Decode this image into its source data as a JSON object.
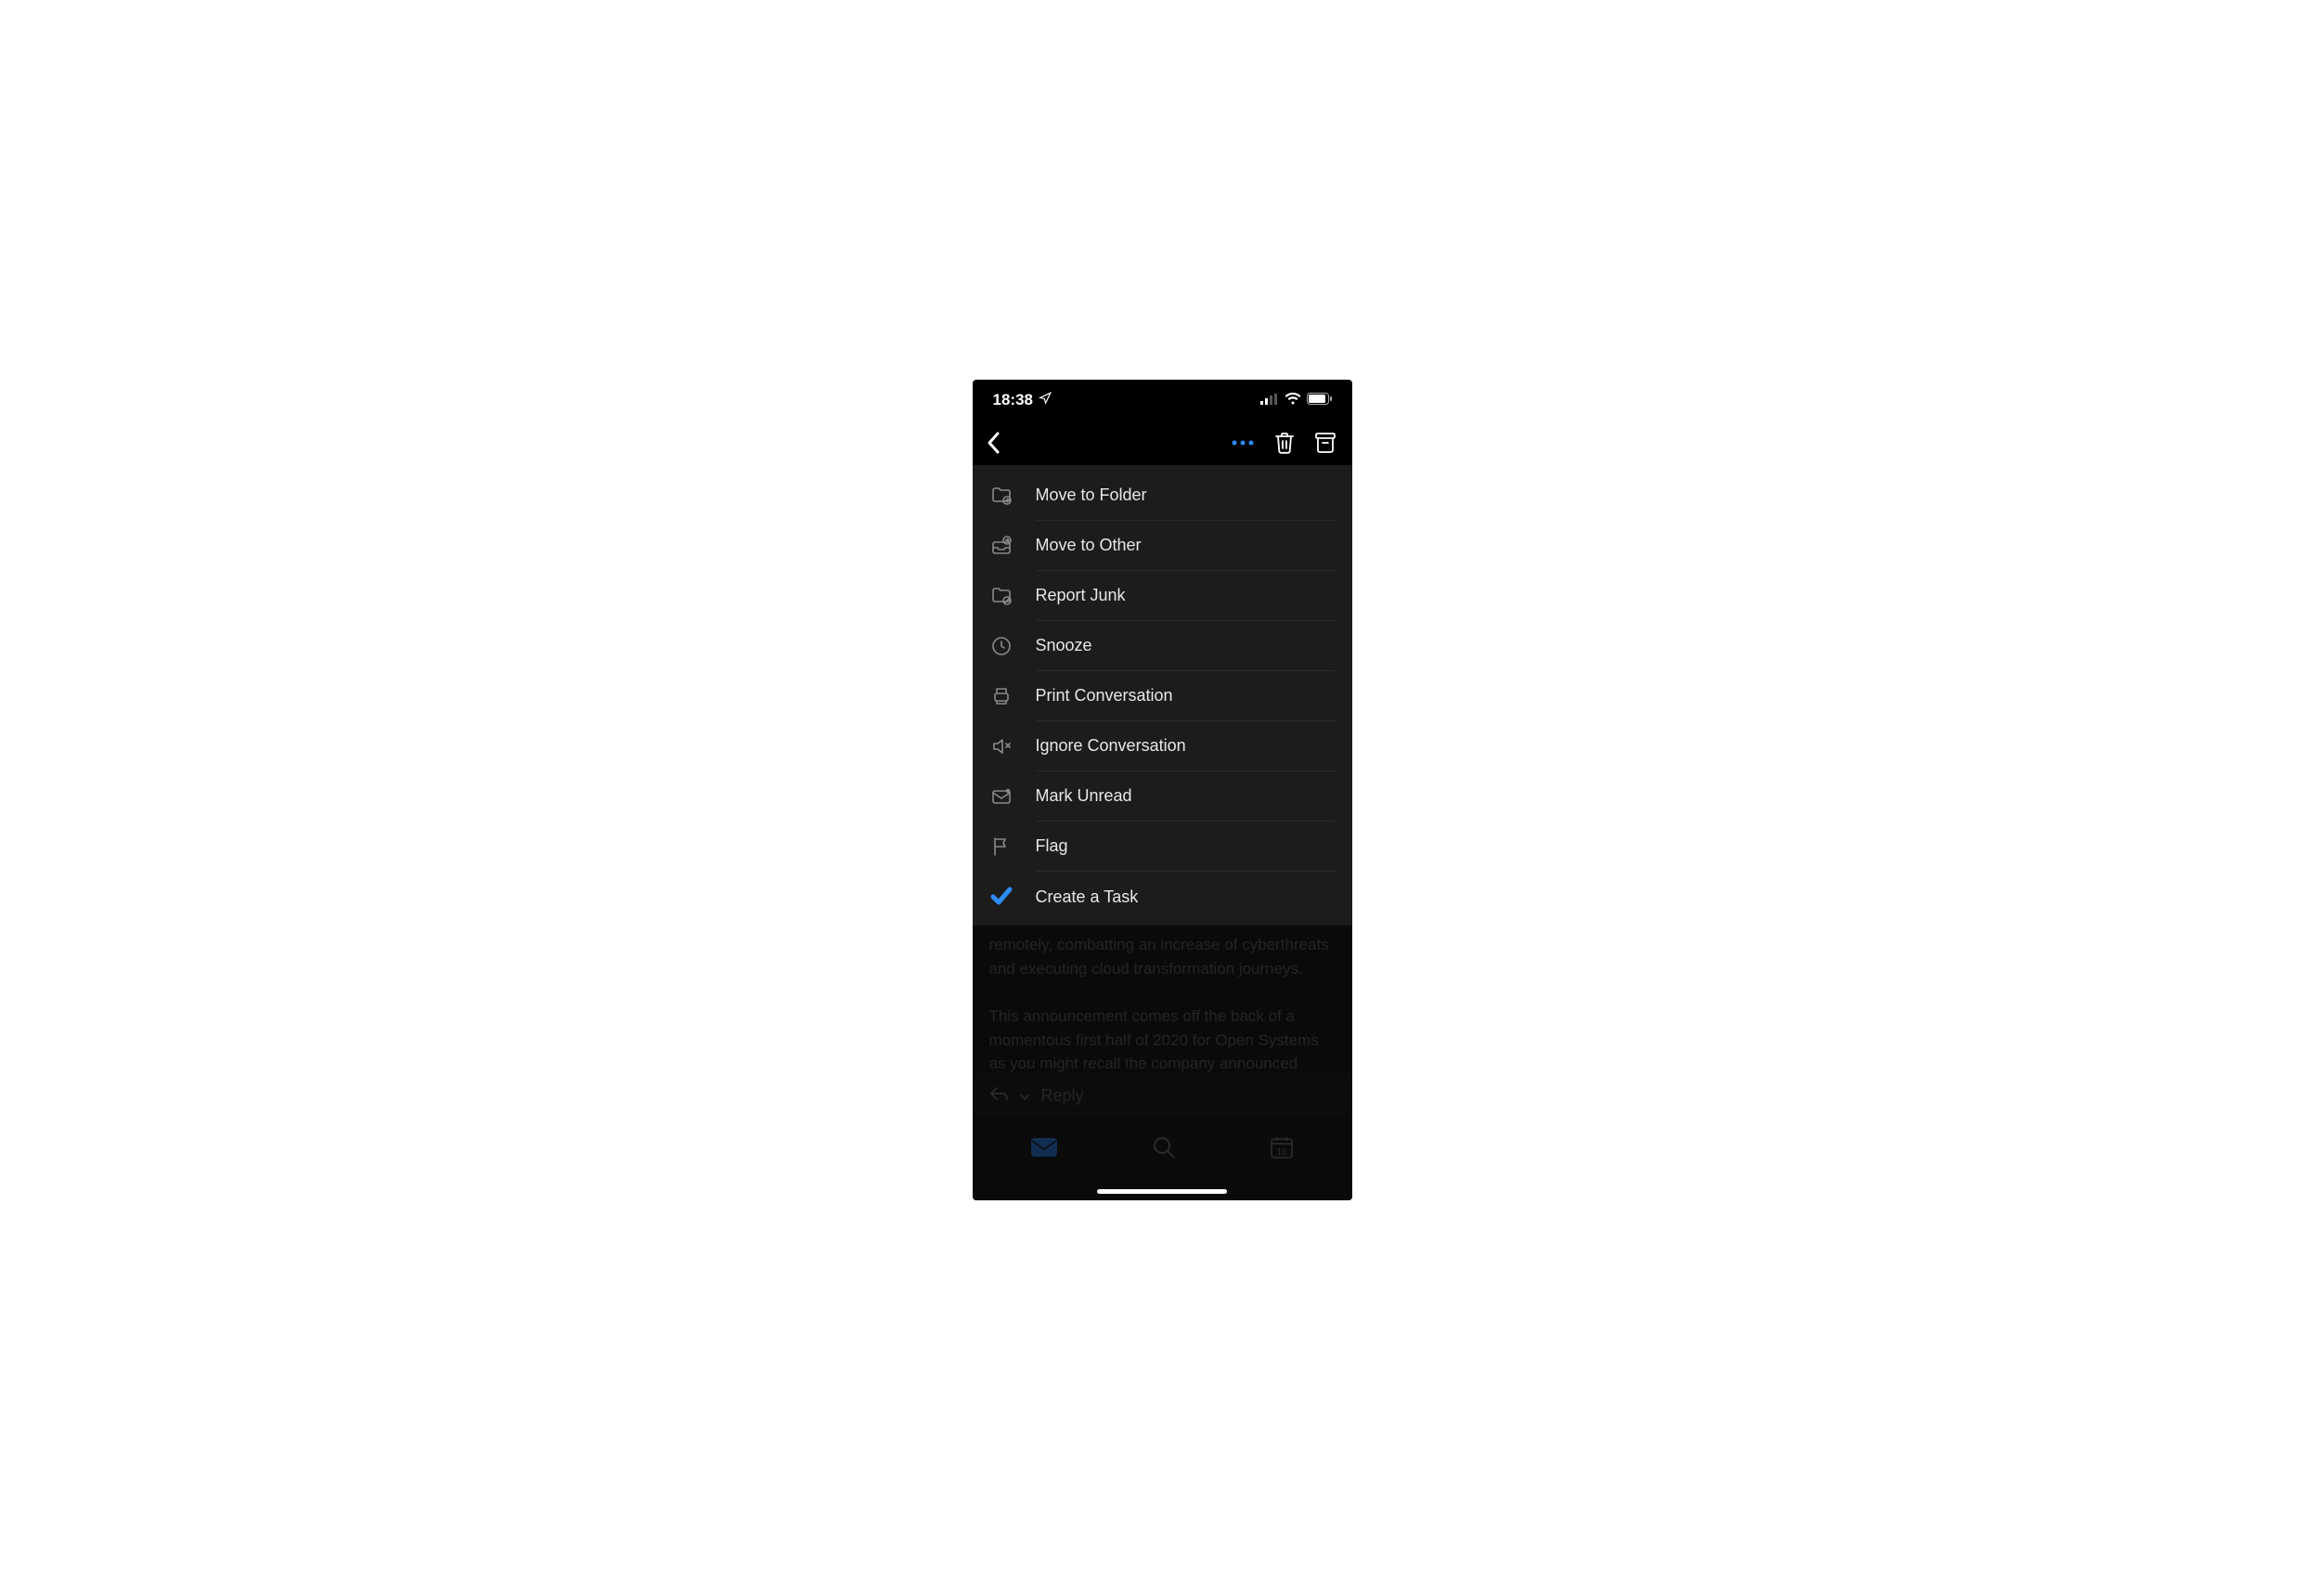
{
  "status": {
    "time": "18:38"
  },
  "menu": {
    "items": [
      {
        "label": "Move to Folder",
        "icon": "folder-arrow-icon",
        "name": "menu-move-to-folder"
      },
      {
        "label": "Move to Other",
        "icon": "tray-arrow-icon",
        "name": "menu-move-to-other"
      },
      {
        "label": "Report Junk",
        "icon": "folder-block-icon",
        "name": "menu-report-junk"
      },
      {
        "label": "Snooze",
        "icon": "clock-icon",
        "name": "menu-snooze"
      },
      {
        "label": "Print Conversation",
        "icon": "printer-icon",
        "name": "menu-print-conversation"
      },
      {
        "label": "Ignore Conversation",
        "icon": "speaker-mute-icon",
        "name": "menu-ignore-conversation"
      },
      {
        "label": "Mark Unread",
        "icon": "mail-unread-icon",
        "name": "menu-mark-unread"
      },
      {
        "label": "Flag",
        "icon": "flag-icon",
        "name": "menu-flag"
      },
      {
        "label": "Create a Task",
        "icon": "task-check-icon",
        "name": "menu-create-task",
        "iconColor": "#2f8cff"
      }
    ]
  },
  "body": {
    "p1": "remotely, combatting an increase of cyberthreats and executing cloud transformation journeys.",
    "p2": "This announcement comes off the back of a momentous first half of 2020 for Open Systems as you might recall the company announced"
  },
  "reply": {
    "label": "Reply"
  },
  "tabs": {
    "calendarDay": "16"
  }
}
